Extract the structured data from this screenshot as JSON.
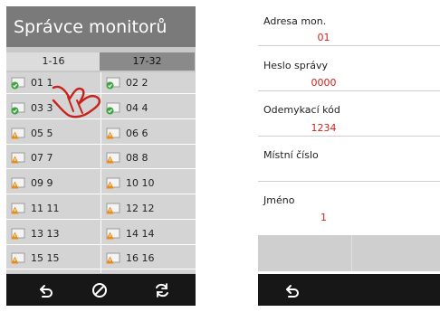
{
  "left_panel": {
    "title": "Správce monitorů",
    "tabs": [
      "1-16",
      "17-32"
    ],
    "monitors": [
      {
        "label": "01 1",
        "status": "ok"
      },
      {
        "label": "02 2",
        "status": "ok"
      },
      {
        "label": "03 3",
        "status": "ok"
      },
      {
        "label": "04 4",
        "status": "ok"
      },
      {
        "label": "05 5",
        "status": "warning"
      },
      {
        "label": "06 6",
        "status": "warning"
      },
      {
        "label": "07 7",
        "status": "warning"
      },
      {
        "label": "08 8",
        "status": "warning"
      },
      {
        "label": "09 9",
        "status": "warning"
      },
      {
        "label": "10 10",
        "status": "warning"
      },
      {
        "label": "11 11",
        "status": "warning"
      },
      {
        "label": "12 12",
        "status": "warning"
      },
      {
        "label": "13 13",
        "status": "warning"
      },
      {
        "label": "14 14",
        "status": "warning"
      },
      {
        "label": "15 15",
        "status": "warning"
      },
      {
        "label": "16 16",
        "status": "warning"
      }
    ],
    "bottom_icons": [
      "back-icon",
      "cancel-icon",
      "refresh-icon"
    ]
  },
  "right_panel": {
    "fields": [
      {
        "label": "Adresa mon.",
        "value": "01"
      },
      {
        "label": "Heslo správy",
        "value": "0000"
      },
      {
        "label": "Odemykací kód",
        "value": "1234"
      },
      {
        "label": "Místní číslo",
        "value": ""
      },
      {
        "label": "Jméno",
        "value": "1"
      }
    ],
    "bottom_icons": [
      "back-icon"
    ]
  },
  "colors": {
    "title_bar": "#7a7a7a",
    "value_red": "#d0211c",
    "status_ok": "#3aa53a",
    "status_warning": "#f08a12",
    "bottom_bar": "#171717"
  }
}
